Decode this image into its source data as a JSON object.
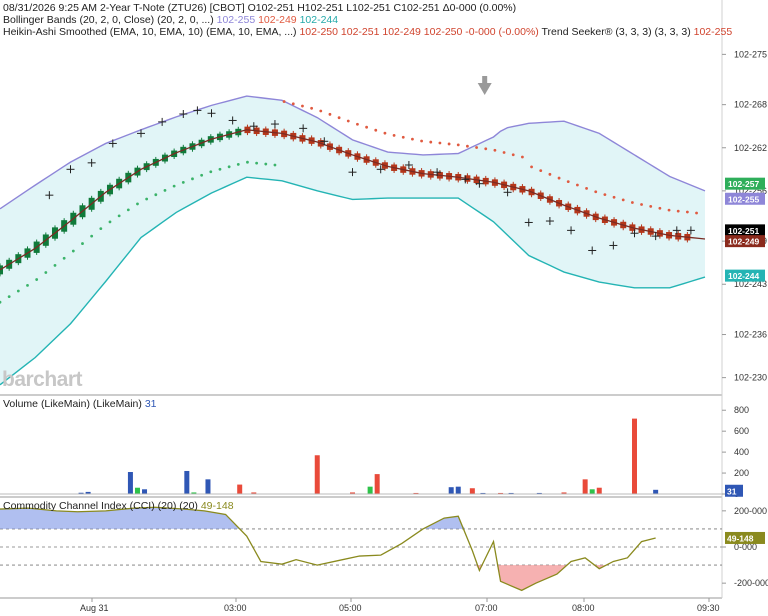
{
  "header": {
    "timestamp": "08/31/2026",
    "time": "9:25 AM",
    "instrument": "2-Year T-Note (ZTU26) [CBOT]",
    "ohlc": "O102-251 H102-251 L102-251 C102-251",
    "change": "Δ0-000 (0.00%)"
  },
  "legend": {
    "bollinger_name": "Bollinger Bands (20, 2, 0, Close)",
    "bollinger_params": "(20, 2, 0, ...)",
    "bollinger_upper": "102-255",
    "bollinger_mid": "102-249",
    "bollinger_lower": "102-244",
    "heikin_name": "Heikin-Ashi Smoothed (EMA, 10, EMA, 10)",
    "heikin_params": "(EMA, 10, EMA, ...)",
    "heikin_values": "102-250 102-251 102-249 102-250 -0-000 (-0.00%)",
    "trend_name": "Trend Seeker® (3, 3, 3)",
    "trend_params": "(3, 3, 3)",
    "trend_value": "102-255",
    "volume_name": "Volume (LikeMain)",
    "volume_params": "(LikeMain)",
    "volume_value": "31",
    "cci_name": "Commodity Channel Index (CCI) (20)",
    "cci_params": "(20)",
    "cci_value": "49-148"
  },
  "brand": "barchart",
  "colors": {
    "band_fill": "#e1f5f7",
    "band_upper": "#8e86d8",
    "band_lower": "#24b4b4",
    "heikin_up": "#0f7a3a",
    "heikin_down": "#b4361a",
    "heikin_line": "#7a2b23",
    "trend_up": "#3bb36a",
    "trend_down": "#e05a40",
    "bar_black": "#222222",
    "vol_up": "#2ec24a",
    "vol_down": "#e94a3a",
    "vol_neutral": "#2f57b5",
    "cci_line": "#8a8a1e",
    "cci_over": "#3a5fd0",
    "cci_under": "#e94a3a"
  },
  "chart_data": [
    {
      "type": "candlestick",
      "title": "2-Year T-Note (ZTU26) [CBOT]",
      "x_ticks": [
        "Aug 31",
        "03:00",
        "05:00",
        "07:00",
        "08:00",
        "09:30"
      ],
      "y_ticks": [
        "102-275",
        "102-268",
        "102-262",
        "102-256",
        "102-249",
        "102-243",
        "102-236",
        "102-230"
      ],
      "y_ticks_numeric": [
        102.275,
        102.268,
        102.262,
        102.256,
        102.249,
        102.243,
        102.236,
        102.23
      ],
      "ylim": [
        102.228,
        102.277
      ],
      "price_labels": [
        {
          "text": "102-257",
          "value": 102.257,
          "color": "#2eae5a"
        },
        {
          "text": "102-255",
          "value": 102.2549,
          "color": "#8e86d8"
        },
        {
          "text": "102-251",
          "value": 102.2505,
          "color": "#000000"
        },
        {
          "text": "102-249",
          "value": 102.249,
          "color": "#8b2a1c"
        },
        {
          "text": "102-244",
          "value": 102.2442,
          "color": "#24b4b4"
        }
      ],
      "series": [
        {
          "name": "Bollinger Upper",
          "x": [
            0,
            10,
            20,
            30,
            40,
            50,
            60,
            70,
            80,
            90,
            100,
            110,
            120,
            130,
            140,
            143,
            150,
            160,
            170,
            180,
            190,
            200
          ],
          "values": [
            102.2535,
            102.2568,
            102.26,
            102.2626,
            102.2645,
            102.2663,
            102.2679,
            102.2692,
            102.2686,
            102.2662,
            102.2631,
            102.2614,
            102.261,
            102.2612,
            102.2635,
            102.2647,
            102.2654,
            102.2657,
            102.264,
            102.261,
            102.258,
            102.256
          ]
        },
        {
          "name": "Bollinger Lower",
          "x": [
            0,
            10,
            20,
            30,
            40,
            50,
            60,
            70,
            80,
            90,
            100,
            110,
            120,
            130,
            140,
            150,
            160,
            170,
            180,
            190,
            200
          ],
          "values": [
            102.229,
            102.2328,
            102.2375,
            102.2434,
            102.2495,
            102.253,
            102.2557,
            102.2579,
            102.2574,
            102.256,
            102.2548,
            102.255,
            102.255,
            102.255,
            102.2517,
            102.247,
            102.2447,
            102.2433,
            102.2425,
            102.2425,
            102.244
          ]
        },
        {
          "name": "Heikin-Ashi Smoothed",
          "x": [
            0,
            10,
            20,
            30,
            40,
            50,
            60,
            70,
            80,
            90,
            100,
            110,
            120,
            130,
            140,
            150,
            160,
            170,
            180,
            190,
            200
          ],
          "values": [
            102.245,
            102.248,
            102.2518,
            102.2558,
            102.259,
            102.2613,
            102.2632,
            102.2645,
            102.264,
            102.2628,
            102.261,
            102.2594,
            102.2584,
            102.2579,
            102.2572,
            102.256,
            102.254,
            102.2522,
            102.2508,
            102.2498,
            102.2493
          ]
        }
      ]
    },
    {
      "type": "bar",
      "title": "Volume (LikeMain)",
      "y_ticks": [
        0,
        200,
        400,
        600,
        800
      ],
      "ylim": [
        0,
        850
      ],
      "categories": [
        "Aug 31",
        "03:00",
        "05:00",
        "07:00",
        "08:00",
        "09:30"
      ],
      "bars": [
        {
          "x": 23,
          "v": 12
        },
        {
          "x": 25,
          "v": 20
        },
        {
          "x": 37,
          "v": 210
        },
        {
          "x": 39,
          "v": 60
        },
        {
          "x": 41,
          "v": 45
        },
        {
          "x": 53,
          "v": 220
        },
        {
          "x": 55,
          "v": 15
        },
        {
          "x": 59,
          "v": 140
        },
        {
          "x": 68,
          "v": 90
        },
        {
          "x": 72,
          "v": 15
        },
        {
          "x": 90,
          "v": 370
        },
        {
          "x": 100,
          "v": 15
        },
        {
          "x": 105,
          "v": 70
        },
        {
          "x": 107,
          "v": 190
        },
        {
          "x": 118,
          "v": 10
        },
        {
          "x": 128,
          "v": 65
        },
        {
          "x": 130,
          "v": 70
        },
        {
          "x": 134,
          "v": 55
        },
        {
          "x": 137,
          "v": 10
        },
        {
          "x": 142,
          "v": 10
        },
        {
          "x": 145,
          "v": 10
        },
        {
          "x": 153,
          "v": 10
        },
        {
          "x": 160,
          "v": 15
        },
        {
          "x": 166,
          "v": 140
        },
        {
          "x": 168,
          "v": 45
        },
        {
          "x": 170,
          "v": 60
        },
        {
          "x": 180,
          "v": 720
        },
        {
          "x": 186,
          "v": 40
        }
      ],
      "current": "31"
    },
    {
      "type": "line",
      "title": "Commodity Channel Index (CCI) (20)",
      "y_ticks": [
        200,
        0,
        -200
      ],
      "y_tick_labels": [
        "200-000",
        "0-000",
        "-200-000"
      ],
      "ylim": [
        -260,
        260
      ],
      "x": [
        0,
        8,
        16,
        22,
        30,
        38,
        44,
        52,
        58,
        64,
        70,
        74,
        80,
        84,
        90,
        96,
        102,
        108,
        114,
        120,
        126,
        130,
        134,
        136,
        140,
        142,
        148,
        152,
        158,
        162,
        166,
        170,
        174,
        178,
        182,
        186
      ],
      "values": [
        210,
        215,
        200,
        195,
        200,
        215,
        220,
        210,
        200,
        180,
        60,
        -80,
        -95,
        -70,
        -100,
        -75,
        -50,
        -45,
        20,
        100,
        160,
        170,
        -20,
        -130,
        30,
        -190,
        -240,
        -200,
        -150,
        -80,
        -60,
        -120,
        -80,
        -60,
        30,
        50
      ],
      "current": "49-148"
    }
  ]
}
